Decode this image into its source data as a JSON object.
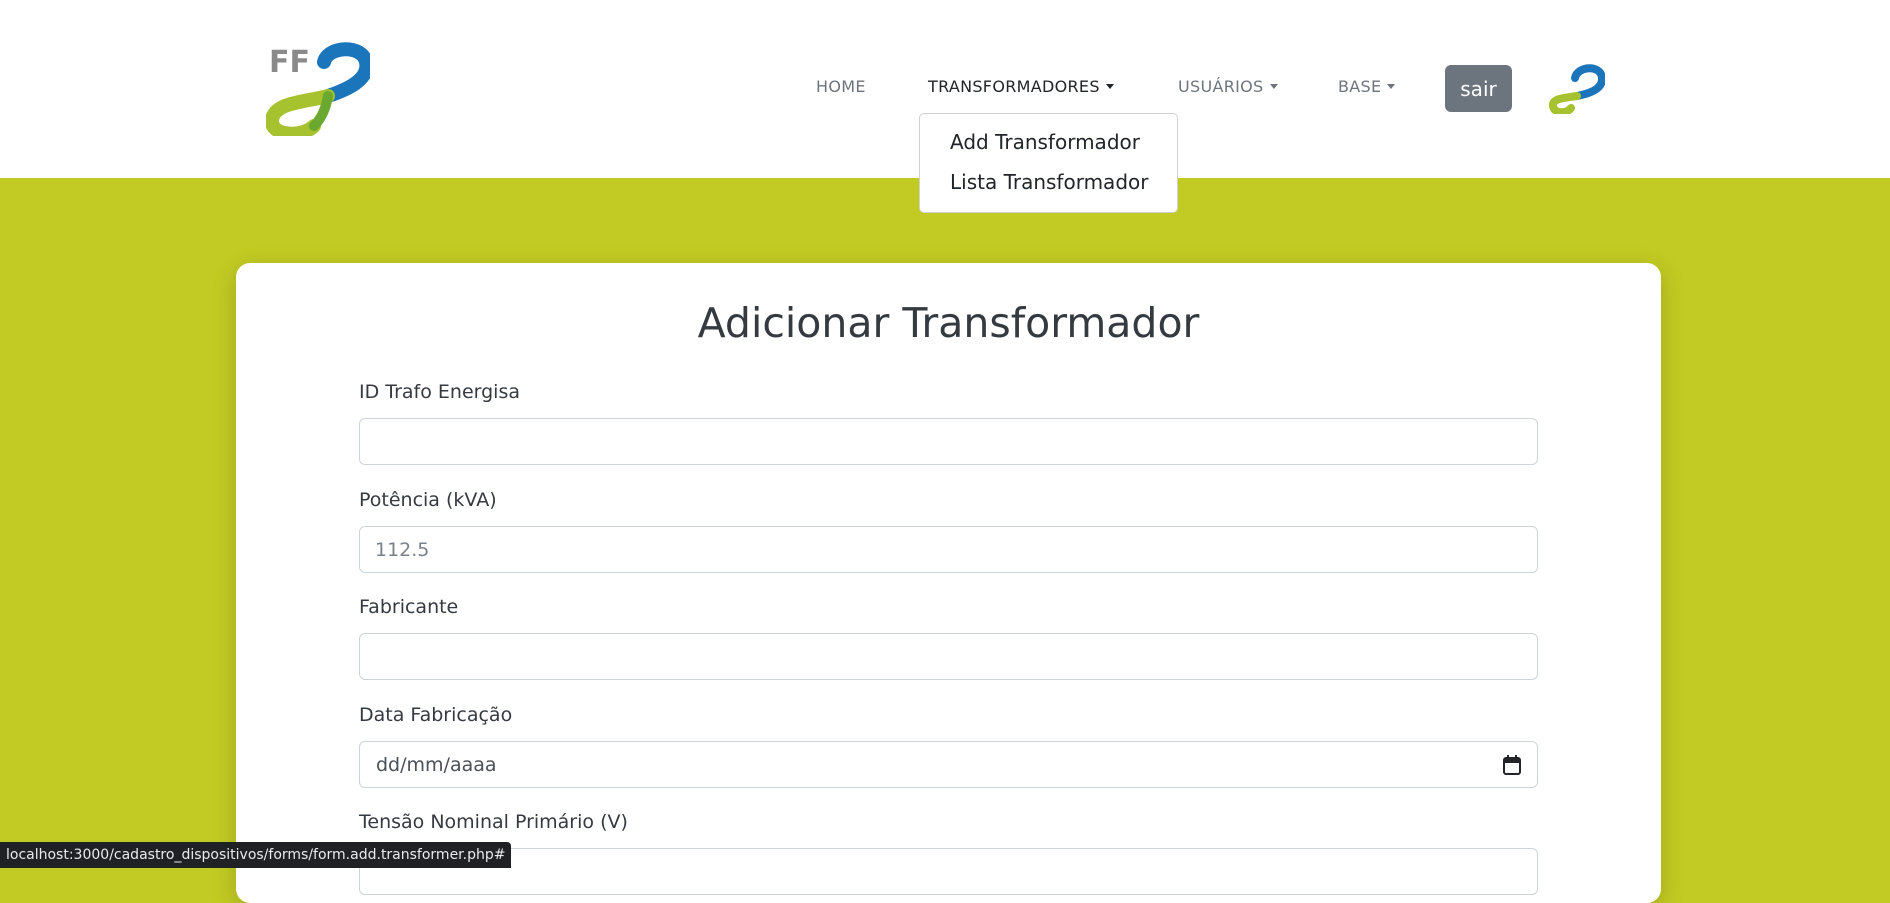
{
  "header": {
    "nav": [
      {
        "label": "HOME",
        "has_caret": false
      },
      {
        "label": "TRANSFORMADORES",
        "has_caret": true,
        "active": true
      },
      {
        "label": "USUÁRIOS",
        "has_caret": true
      },
      {
        "label": "BASE",
        "has_caret": true
      }
    ],
    "logout_label": "sair",
    "logo_text": "FF"
  },
  "dropdown": {
    "items": [
      "Add Transformador",
      "Lista Transformador"
    ]
  },
  "form": {
    "title": "Adicionar Transformador",
    "fields": [
      {
        "label": "ID Trafo Energisa",
        "value": "",
        "placeholder": ""
      },
      {
        "label": "Potência (kVA)",
        "value": "",
        "placeholder": "112.5"
      },
      {
        "label": "Fabricante",
        "value": "",
        "placeholder": ""
      },
      {
        "label": "Data Fabricação",
        "value": "dd/mm/aaaa",
        "type": "date"
      },
      {
        "label": "Tensão Nominal Primário (V)",
        "value": "",
        "placeholder": ""
      }
    ]
  },
  "status_bar": {
    "url": "localhost:3000/cadastro_dispositivos/forms/form.add.transformer.php#"
  },
  "colors": {
    "accent_green": "#c2cb23",
    "logo_blue": "#1b75bb",
    "logo_green": "#a6c22e",
    "button_gray": "#6c757d"
  }
}
